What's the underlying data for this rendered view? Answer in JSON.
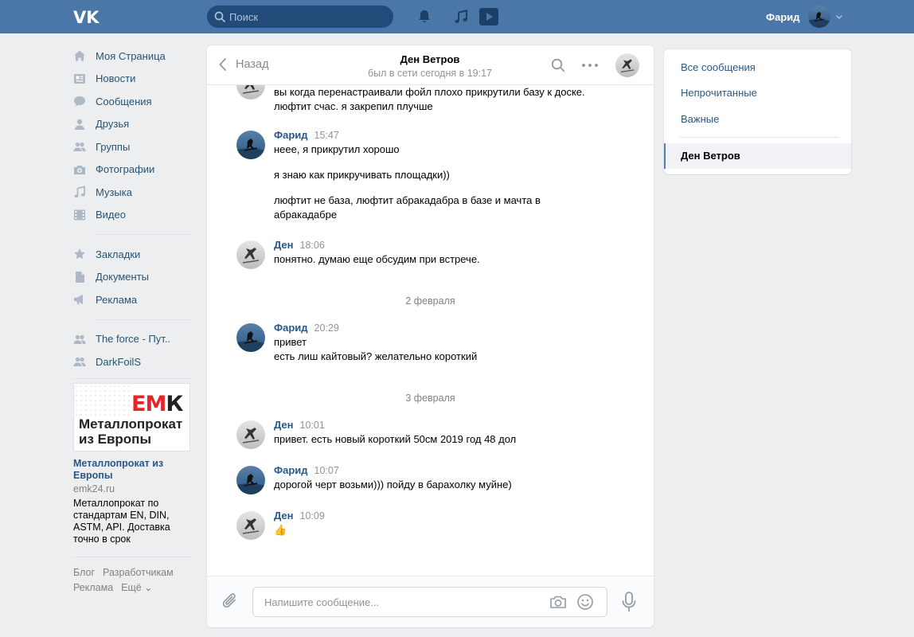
{
  "topbar": {
    "search_placeholder": "Поиск",
    "user_name": "Фарид"
  },
  "sidebar": {
    "items": [
      {
        "label": "Моя Страница",
        "icon": "home-icon"
      },
      {
        "label": "Новости",
        "icon": "news-icon"
      },
      {
        "label": "Сообщения",
        "icon": "messages-icon"
      },
      {
        "label": "Друзья",
        "icon": "friends-icon"
      },
      {
        "label": "Группы",
        "icon": "groups-icon"
      },
      {
        "label": "Фотографии",
        "icon": "camera-icon"
      },
      {
        "label": "Музыка",
        "icon": "music-icon"
      },
      {
        "label": "Видео",
        "icon": "video-icon"
      }
    ],
    "items2": [
      {
        "label": "Закладки",
        "icon": "star-icon"
      },
      {
        "label": "Документы",
        "icon": "document-icon"
      },
      {
        "label": "Реклама",
        "icon": "megaphone-icon"
      }
    ],
    "communities": [
      {
        "label": "The force - Пут..",
        "icon": "group-icon"
      },
      {
        "label": "DarkFoilS",
        "icon": "group-icon"
      }
    ],
    "ad": {
      "logo_text_1": "ЕМ",
      "logo_text_2": "К",
      "image_text_1": "Металлопрокат",
      "image_text_2": "из Европы",
      "title": "Металлопрокат из Европы",
      "site": "emk24.ru",
      "description": "Металлопрокат по стандартам EN, DIN, ASTM, API. Доставка точно в срок"
    },
    "footer": {
      "blog": "Блог",
      "developers": "Разработчикам",
      "ads": "Реклама",
      "more": "Ещё ⌄"
    }
  },
  "chat": {
    "back_label": "Назад",
    "peer_name": "Ден Ветров",
    "peer_status": "был в сети сегодня в 19:17",
    "messages": [
      {
        "author": "",
        "time": "",
        "texts": [
          "вы когда перенастраивали фойл плохо прикрутили базу к доске. люфтит счас. я закрепил плучше"
        ]
      },
      {
        "author": "Фарид",
        "time": "15:47",
        "texts": [
          "неее, я прикрутил хорошо",
          "я знаю как прикручивать площадки))",
          "люфтит не база, люфтит абракадабра в базе и мачта в абракадабре"
        ]
      },
      {
        "author": "Ден",
        "time": "18:06",
        "texts": [
          "понятно. думаю еще обсудим при встрече."
        ]
      },
      {
        "author": "Фарид",
        "time": "20:29",
        "texts": [
          "привет",
          "есть лиш кайтовый? желательно короткий"
        ]
      },
      {
        "author": "Ден",
        "time": "10:01",
        "texts": [
          "привет. есть новый короткий 50см 2019 год 48 дол"
        ]
      },
      {
        "author": "Фарид",
        "time": "10:07",
        "texts": [
          "дорогой черт возьми))) пойду в барахолку муйне)"
        ]
      },
      {
        "author": "Ден",
        "time": "10:09",
        "texts": [
          "👍"
        ]
      }
    ],
    "days": [
      "2 февраля",
      "3 февраля"
    ],
    "composer_placeholder": "Напишите сообщение..."
  },
  "right_panel": {
    "all": "Все сообщения",
    "unread": "Непрочитанные",
    "important": "Важные",
    "active": "Ден Ветров"
  },
  "colors": {
    "header": "#4a76a8",
    "link": "#2a5885",
    "accent": "#5181b8"
  }
}
